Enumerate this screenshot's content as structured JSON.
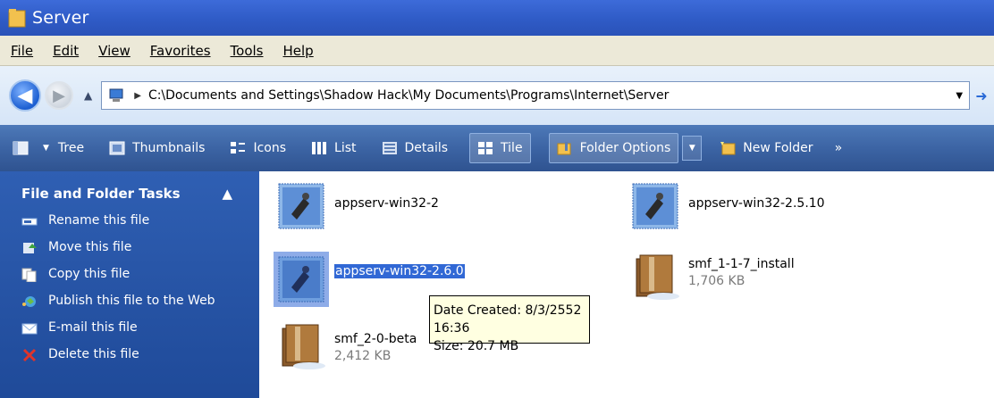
{
  "window": {
    "title": "Server"
  },
  "menu": [
    "File",
    "Edit",
    "View",
    "Favorites",
    "Tools",
    "Help"
  ],
  "address": {
    "path": "C:\\Documents and Settings\\Shadow Hack\\My Documents\\Programs\\Internet\\Server"
  },
  "toolbar": {
    "tree": "Tree",
    "thumbnails": "Thumbnails",
    "icons": "Icons",
    "list": "List",
    "details": "Details",
    "tile": "Tile",
    "folder_options": "Folder Options",
    "new_folder": "New Folder",
    "more": "»"
  },
  "sidebar": {
    "header": "File and Folder Tasks",
    "collapse": "▲",
    "tasks": [
      {
        "label": "Rename this file"
      },
      {
        "label": "Move this file"
      },
      {
        "label": "Copy this file"
      },
      {
        "label": "Publish this file to the Web"
      },
      {
        "label": "E-mail this file"
      },
      {
        "label": "Delete this file"
      }
    ]
  },
  "files": [
    {
      "name": "appserv-win32-2",
      "size": ""
    },
    {
      "name": "appserv-win32-2.5.10",
      "size": ""
    },
    {
      "name": "appserv-win32-2.6.0",
      "size": ""
    },
    {
      "name": "smf_1-1-7_install",
      "size": "1,706 KB"
    },
    {
      "name": "smf_2-0-beta",
      "size": "2,412 KB"
    }
  ],
  "tooltip": {
    "created": "Date Created: 8/3/2552 16:36",
    "size": "Size: 20.7 MB"
  },
  "colors": {
    "title_bar": "#2f5bc6",
    "toolbar": "#3c64a4",
    "sidebar": "#2f5fb3",
    "selection": "#3168d5"
  }
}
